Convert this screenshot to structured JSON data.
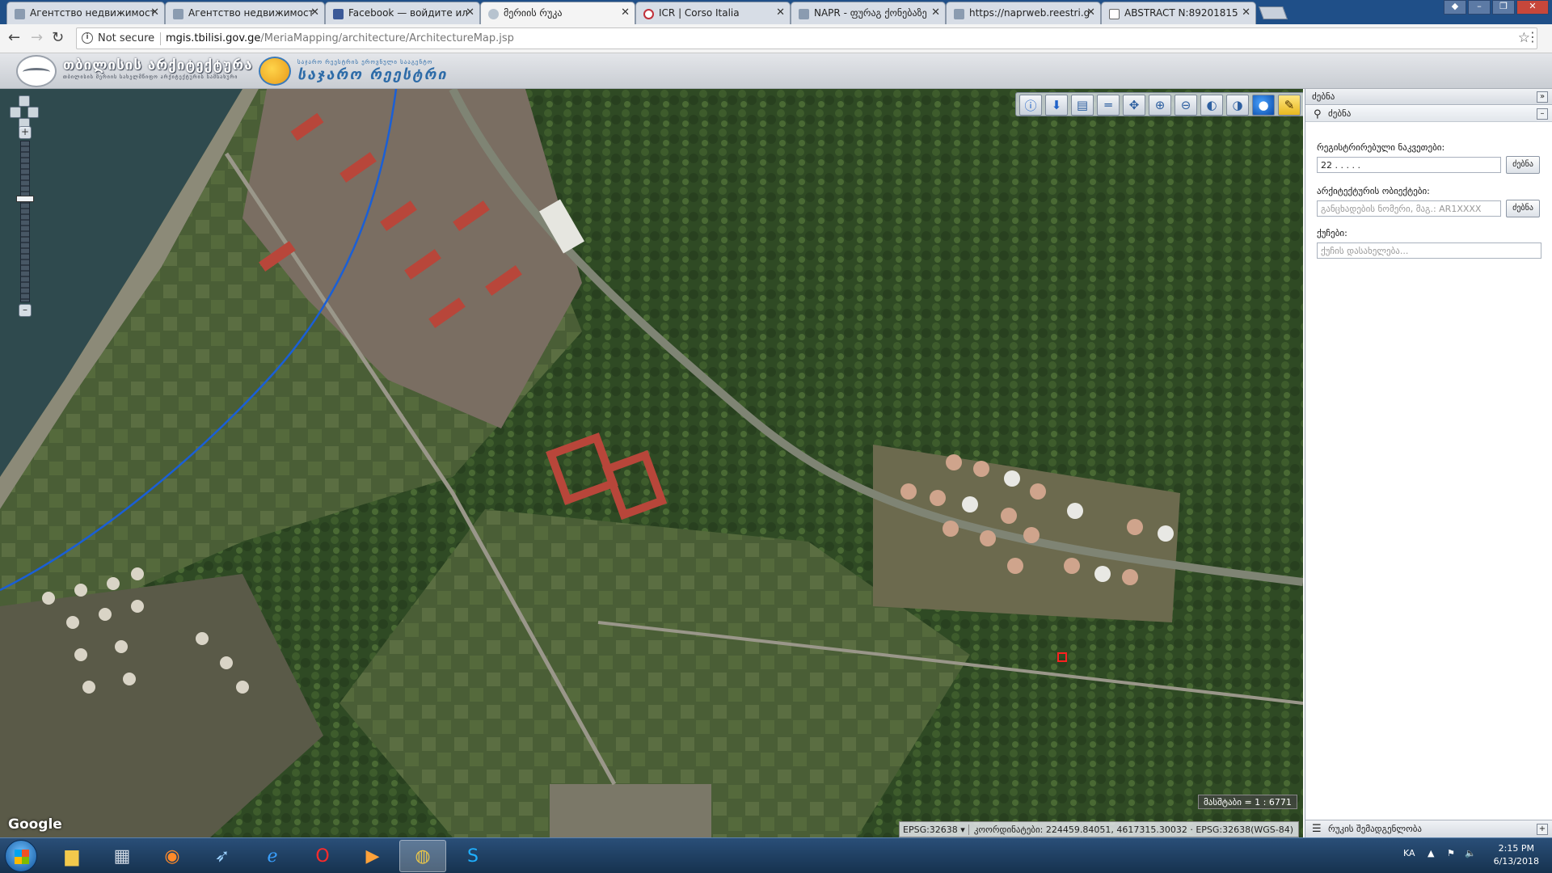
{
  "browser": {
    "tabs": [
      {
        "title": "Агентство недвижимост",
        "icon": "page-icon",
        "active": false
      },
      {
        "title": "Агентство недвижимост",
        "icon": "page-icon",
        "active": false
      },
      {
        "title": "Facebook — войдите ил",
        "icon": "facebook-icon",
        "active": false
      },
      {
        "title": "მერიის რუკა",
        "icon": "globe-icon",
        "active": true
      },
      {
        "title": "ICR | Corso Italia",
        "icon": "icr-icon",
        "active": false
      },
      {
        "title": "NAPR - ფურაგ ქონებაზე",
        "icon": "page-icon",
        "active": false
      },
      {
        "title": "https://naprweb.reestri.g",
        "icon": "page-icon",
        "active": false
      },
      {
        "title": "ABSTRACT N:89201815",
        "icon": "document-icon",
        "active": false
      }
    ],
    "security_label": "Not secure",
    "url_host": "mgis.tbilisi.gov.ge",
    "url_path": "/MeriaMapping/architecture/ArchitectureMap.jsp"
  },
  "header": {
    "brand1_title": "თბილისის არქიტექტურა",
    "brand1_sub": "თბილისის მერიის სახელმწიფო არქიტექტურის სამსახური",
    "brand2_sub": "საჯარო რეესტრის ეროვნული სააგენტო",
    "brand2_title": "საჯარო რეესტრი"
  },
  "map": {
    "scale_label": "მასშტაბი = 1 : 6771",
    "google_label": "Google",
    "epsg_select": "EPSG:32638",
    "coords_label": "კოორდინატები: 224459.84051, 4617315.30032 · EPSG:32638(WGS-84)",
    "tool_icons": [
      "info-icon",
      "identify-icon",
      "print-icon",
      "measure-icon",
      "pan-icon",
      "zoom-in-icon",
      "zoom-out-icon",
      "zoom-prev-icon",
      "zoom-next-icon",
      "globe-icon",
      "pen-icon"
    ],
    "colors": {
      "boundary_line": "#1a5fd6",
      "sea": "#2f4a4e",
      "vegetation": "#35502a"
    }
  },
  "panel": {
    "title": "ძებნა",
    "section": "ძებნა",
    "cadastral_label": "რეგისტრირებული ნაკვეთები:",
    "cadastral_value": "22 . . . . .",
    "search_btn": "ძებნა",
    "arch_label": "არქიტექტურის ობიექტები:",
    "arch_placeholder": "განცხადების ნომერი, მაგ.: AR1XXXX",
    "search_btn2": "ძებნა",
    "street_label": "ქუჩები:",
    "street_placeholder": "ქუჩის დასახელება...",
    "footer": "რუკის შემადგენლობა"
  },
  "taskbar": {
    "lang": "KA",
    "time": "2:15 PM",
    "date": "6/13/2018",
    "apps": [
      "explorer-icon",
      "calculator-icon",
      "firefox-icon",
      "rocket-icon",
      "ie-icon",
      "opera-icon",
      "media-player-icon",
      "chrome-icon",
      "skype-icon"
    ]
  }
}
